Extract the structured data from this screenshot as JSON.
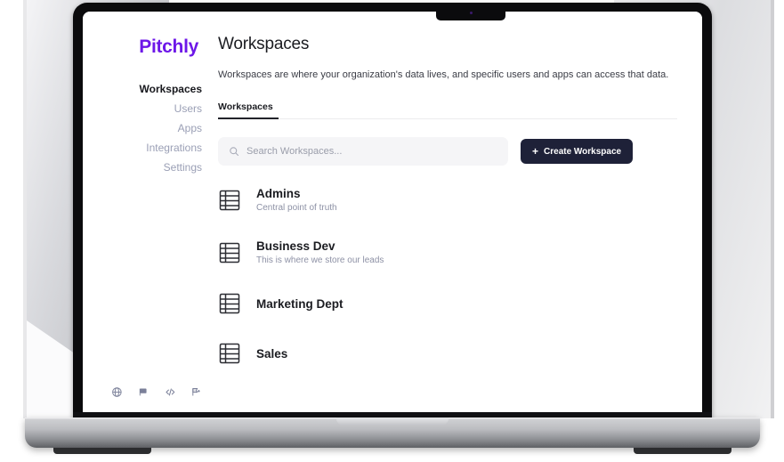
{
  "brand": {
    "logo_text": "Pitchly",
    "logo_color": "#6D17E8"
  },
  "sidebar": {
    "items": [
      {
        "label": "Workspaces",
        "active": true
      },
      {
        "label": "Users",
        "active": false
      },
      {
        "label": "Apps",
        "active": false
      },
      {
        "label": "Integrations",
        "active": false
      },
      {
        "label": "Settings",
        "active": false
      }
    ],
    "bottom_icons": [
      {
        "name": "globe-icon"
      },
      {
        "name": "flag-icon"
      },
      {
        "name": "code-icon"
      },
      {
        "name": "bookmark-flag-icon"
      }
    ]
  },
  "header": {
    "title": "Workspaces",
    "description": "Workspaces are where your organization's data lives, and specific users and apps can access that data."
  },
  "tabs": [
    {
      "label": "Workspaces",
      "active": true
    }
  ],
  "toolbar": {
    "search_placeholder": "Search Workspaces...",
    "search_value": "",
    "create_label": "Create Workspace",
    "create_plus": "+",
    "create_bg": "#1E2138"
  },
  "workspaces": [
    {
      "name": "Admins",
      "description": "Central point of truth"
    },
    {
      "name": "Business Dev",
      "description": "This is where we store our leads"
    },
    {
      "name": "Marketing Dept",
      "description": ""
    },
    {
      "name": "Sales",
      "description": ""
    }
  ]
}
